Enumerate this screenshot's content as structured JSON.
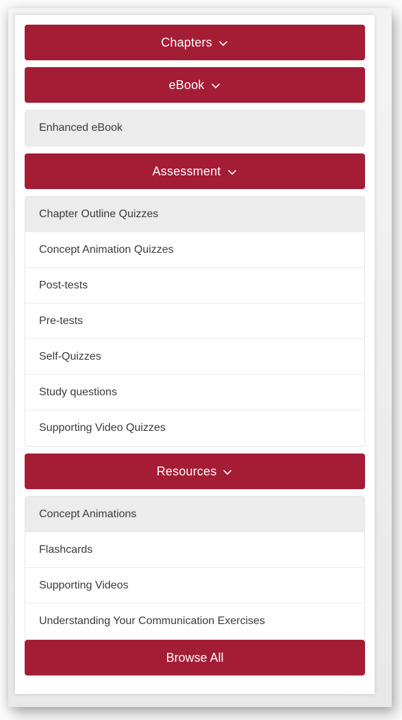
{
  "colors": {
    "accent": "#a51c35",
    "active_bg": "#ececec",
    "text": "#3a3a3a"
  },
  "sections": {
    "chapters": {
      "label": "Chapters",
      "icon": "chevron-down-icon"
    },
    "ebook": {
      "label": "eBook",
      "icon": "chevron-down-icon",
      "items": [
        "Enhanced eBook"
      ]
    },
    "assessment": {
      "label": "Assessment",
      "icon": "chevron-down-icon",
      "items": [
        "Chapter Outline Quizzes",
        "Concept Animation Quizzes",
        "Post-tests",
        "Pre-tests",
        "Self-Quizzes",
        "Study questions",
        "Supporting Video Quizzes"
      ]
    },
    "resources": {
      "label": "Resources",
      "icon": "chevron-down-icon",
      "items": [
        "Concept Animations",
        "Flashcards",
        "Supporting Videos",
        "Understanding Your Communication Exercises"
      ]
    }
  },
  "browse_all": {
    "label": "Browse All"
  }
}
